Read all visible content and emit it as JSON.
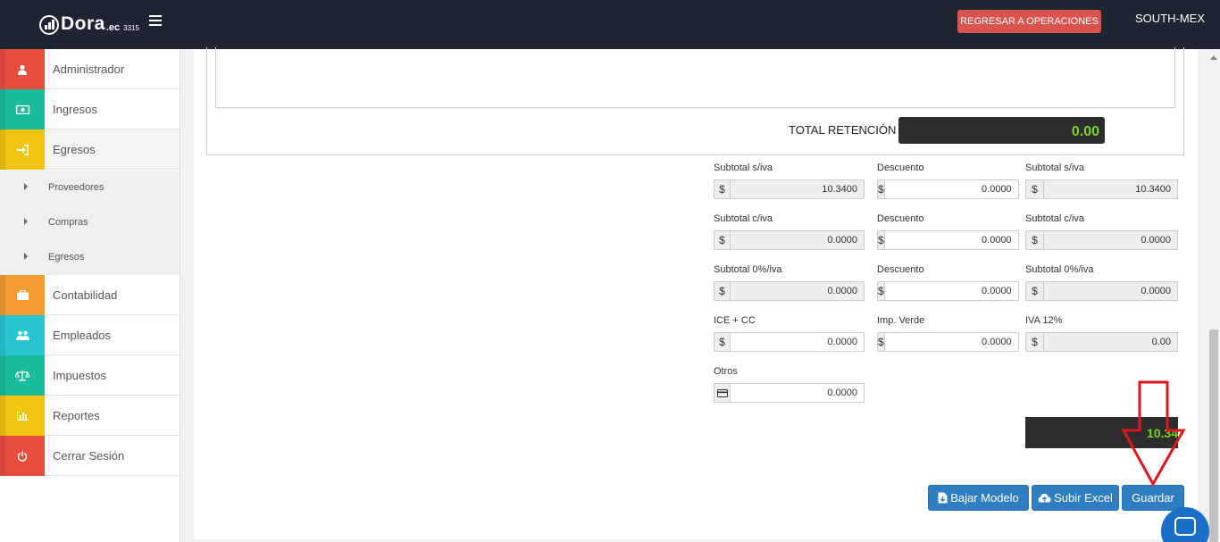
{
  "header": {
    "logo_name": "Dora",
    "logo_suffix": ".ec",
    "logo_number": "3315",
    "back_button": "REGRESAR A OPERACIONES",
    "company": "SOUTH-MEX"
  },
  "sidebar": {
    "items": [
      {
        "label": "Administrador",
        "icon": "user-icon",
        "color": "#e74c3c"
      },
      {
        "label": "Ingresos",
        "icon": "money-icon",
        "color": "#1abc9c"
      },
      {
        "label": "Egresos",
        "icon": "sign-in-icon",
        "color": "#f1c40f"
      },
      {
        "label": "Contabilidad",
        "icon": "briefcase-icon",
        "color": "#f39c33"
      },
      {
        "label": "Empleados",
        "icon": "users-icon",
        "color": "#29c4d0"
      },
      {
        "label": "Impuestos",
        "icon": "balance-scale-icon",
        "color": "#1abc9c"
      },
      {
        "label": "Reportes",
        "icon": "bar-chart-icon",
        "color": "#f1c40f"
      },
      {
        "label": "Cerrar Sesión",
        "icon": "power-icon",
        "color": "#e74c3c"
      }
    ],
    "subitems": [
      "Proveedores",
      "Compras",
      "Egresos"
    ]
  },
  "retention": {
    "label": "TOTAL RETENCIÓN",
    "value": "0.00"
  },
  "totals": {
    "currency_symbol": "$",
    "row1": [
      {
        "label": "Subtotal s/iva",
        "value": "10.3400",
        "readonly": true
      },
      {
        "label": "Descuento",
        "value": "0.0000",
        "readonly": false
      },
      {
        "label": "Subtotal s/iva",
        "value": "10.3400",
        "readonly": true
      }
    ],
    "row2": [
      {
        "label": "Subtotal c/iva",
        "value": "0.0000",
        "readonly": true
      },
      {
        "label": "Descuento",
        "value": "0.0000",
        "readonly": false
      },
      {
        "label": "Subtotal c/iva",
        "value": "0.0000",
        "readonly": true
      }
    ],
    "row3": [
      {
        "label": "Subtotal 0%/iva",
        "value": "0.0000",
        "readonly": true
      },
      {
        "label": "Descuento",
        "value": "0.0000",
        "readonly": false
      },
      {
        "label": "Subtotal 0%/iva",
        "value": "0.0000",
        "readonly": true
      }
    ],
    "row4": [
      {
        "label": "ICE + CC",
        "value": "0.0000",
        "readonly": false
      },
      {
        "label": "Imp. Verde",
        "value": "0.0000",
        "readonly": false
      },
      {
        "label": "IVA 12%",
        "value": "0.00",
        "readonly": true
      }
    ],
    "otros": {
      "label": "Otros",
      "value": "0.0000"
    },
    "grand_total": "10.34"
  },
  "actions": {
    "download_model": "Bajar Modelo",
    "upload_excel": "Subir Excel",
    "save": "Guardar"
  },
  "colors": {
    "navbar": "#1e2432",
    "danger": "#d9534f",
    "primary": "#2f7ec1",
    "total_text": "#7fd12b",
    "annotation_arrow": "#e0161c"
  }
}
